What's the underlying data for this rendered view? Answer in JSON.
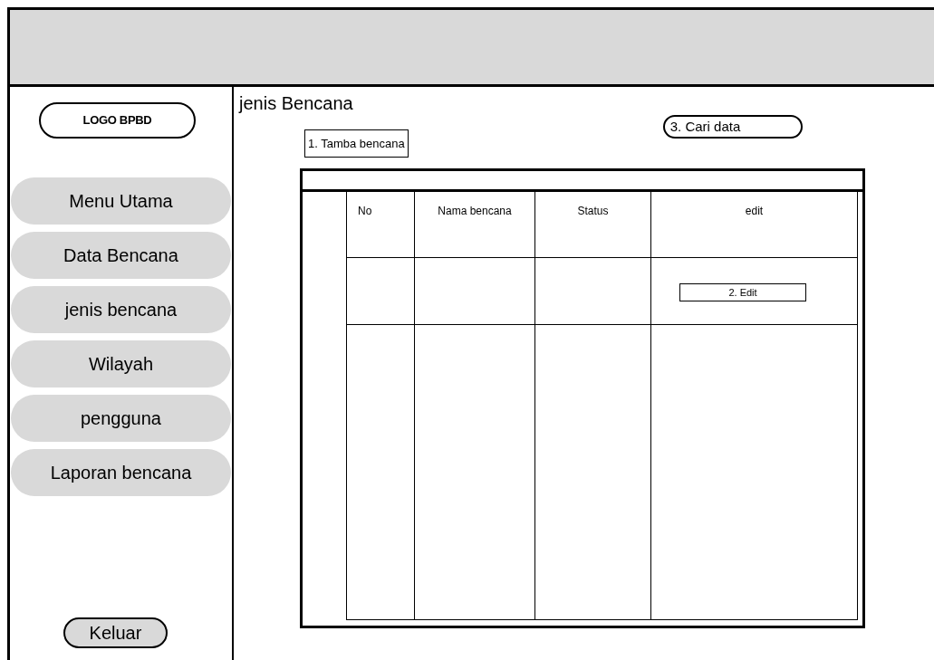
{
  "sidebar": {
    "logo": "LOGO BPBD",
    "items": [
      {
        "label": "Menu Utama"
      },
      {
        "label": "Data Bencana"
      },
      {
        "label": "jenis bencana"
      },
      {
        "label": "Wilayah"
      },
      {
        "label": "pengguna"
      },
      {
        "label": "Laporan bencana"
      }
    ],
    "logout": "Keluar"
  },
  "page_title": "jenis Bencana",
  "add_button": "1. Tamba bencana",
  "search_button": "3. Cari data",
  "table": {
    "columns": [
      "No",
      "Nama bencana",
      "Status",
      "edit"
    ],
    "rows": [
      {
        "edit_button": "2. Edit"
      }
    ]
  }
}
